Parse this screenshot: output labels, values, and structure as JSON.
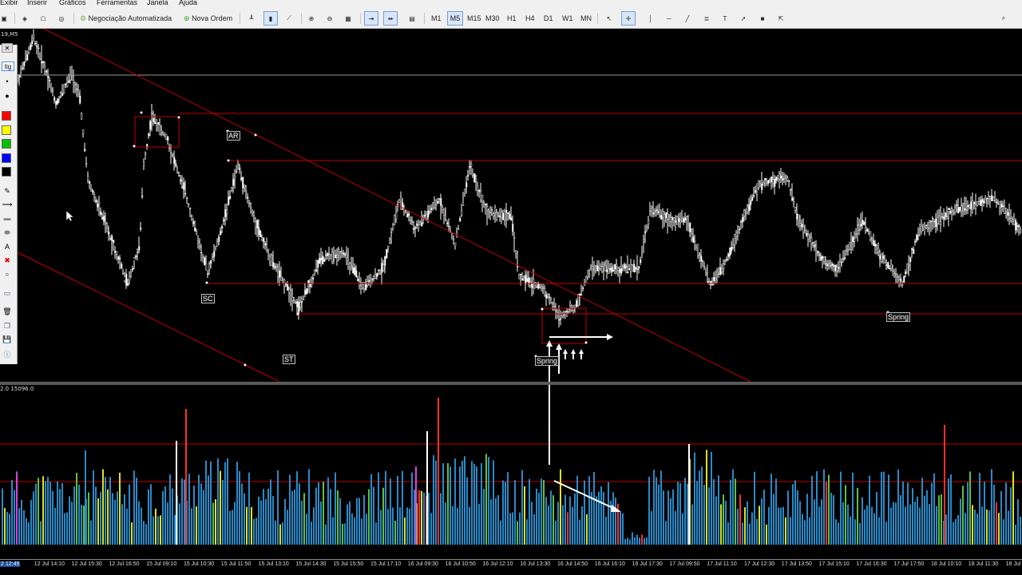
{
  "menu": [
    "Exibir",
    "Inserir",
    "Gráficos",
    "Ferramentas",
    "Janela",
    "Ajuda"
  ],
  "toolbar": {
    "algo_trading_label": "Negociação Automatizada",
    "new_order_label": "Nova Ordem",
    "timeframes": [
      "M1",
      "M5",
      "M15",
      "M30",
      "H1",
      "H4",
      "D1",
      "W1",
      "MN"
    ],
    "active_timeframe": "M5"
  },
  "left_panel": {
    "tab_label": "tig",
    "colors": [
      "#ff0000",
      "#ffff00",
      "#00c000",
      "#0000ff",
      "#000000"
    ]
  },
  "chart": {
    "symbol_label": "19,M5",
    "annotations": {
      "ar": "AR",
      "sc": "SC",
      "st": "ST",
      "spring_left": "Spring",
      "spring_right": "Spring"
    }
  },
  "volume": {
    "header_label": "2.0 15096.0"
  },
  "time_axis": [
    "2 12:45",
    "12 Jul 14:10",
    "12 Jul 15:30",
    "12 Jul 16:50",
    "15 Jul 09:10",
    "15 Jul 10:30",
    "15 Jul 11:50",
    "15 Jul 13:10",
    "15 Jul 14:30",
    "15 Jul 15:50",
    "15 Jul 17:10",
    "16 Jul 09:30",
    "16 Jul 10:50",
    "16 Jul 12:10",
    "16 Jul 13:30",
    "16 Jul 14:50",
    "16 Jul 16:10",
    "16 Jul 17:30",
    "17 Jul 09:50",
    "17 Jul 11:10",
    "17 Jul 12:30",
    "17 Jul 13:50",
    "17 Jul 15:10",
    "17 Jul 16:30",
    "17 Jul 17:50",
    "18 Jul 10:10",
    "18 Jul 11:30",
    "18 Jul"
  ],
  "colors": {
    "background": "#000000",
    "price": "#ffffff",
    "level_line": "#c00000",
    "volume_normal": "#2b8ac8",
    "volume_high": "#60c040",
    "volume_low": "#e0e020",
    "volume_climax": "#ff3030",
    "volume_magenta": "#e040e0",
    "volume_white": "#ffffff"
  }
}
